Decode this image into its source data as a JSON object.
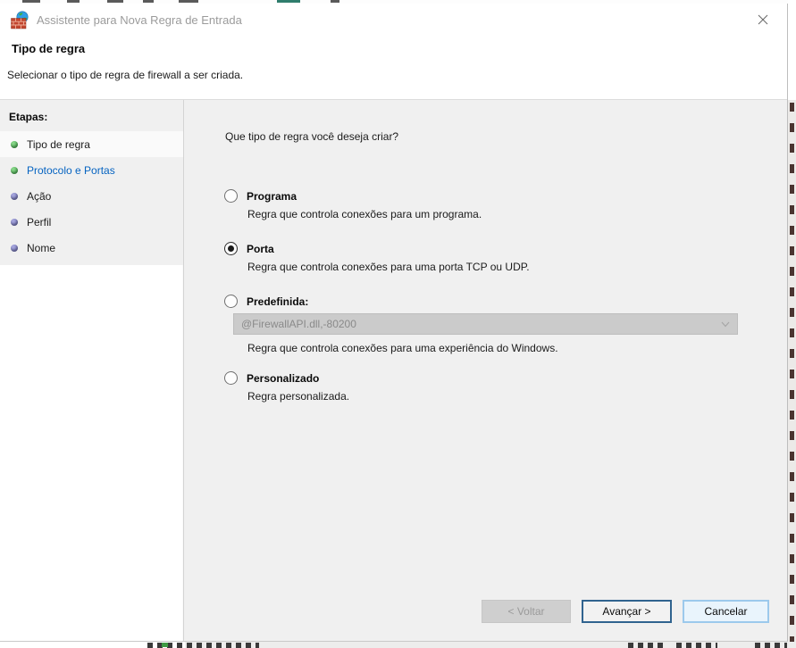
{
  "titlebar": {
    "title": "Assistente para Nova Regra de Entrada",
    "app_icon": "firewall-icon",
    "close_icon": "close-icon"
  },
  "header": {
    "title": "Tipo de regra",
    "subtitle": "Selecionar o tipo de regra de firewall a ser criada."
  },
  "sidebar": {
    "heading": "Etapas:",
    "steps": [
      {
        "label": "Tipo de regra",
        "current": true,
        "bullet_color": "#3fae49",
        "bullet_highlight": "#8fd98f",
        "label_color": "#1b1b1b"
      },
      {
        "label": "Protocolo e Portas",
        "current": false,
        "bullet_color": "#3fae49",
        "bullet_highlight": "#8fd98f",
        "label_color": "#0563c1"
      },
      {
        "label": "Ação",
        "current": false,
        "bullet_color": "#6f70bd",
        "bullet_highlight": "#aaaade",
        "label_color": "#1b1b1b"
      },
      {
        "label": "Perfil",
        "current": false,
        "bullet_color": "#6f70bd",
        "bullet_highlight": "#aaaade",
        "label_color": "#1b1b1b"
      },
      {
        "label": "Nome",
        "current": false,
        "bullet_color": "#6f70bd",
        "bullet_highlight": "#aaaade",
        "label_color": "#1b1b1b"
      }
    ]
  },
  "main": {
    "question": "Que tipo de regra você deseja criar?",
    "options": [
      {
        "label": "Programa",
        "selected": false,
        "description": "Regra que controla conexões para um programa."
      },
      {
        "label": "Porta",
        "selected": true,
        "description": "Regra que controla conexões para uma porta TCP ou UDP."
      },
      {
        "label": "Predefinida:",
        "selected": false,
        "description": "Regra que controla conexões para uma experiência do Windows.",
        "dropdown": {
          "value": "@FirewallAPI.dll,-80200",
          "disabled": true,
          "chevron_icon": "chevron-down-icon"
        }
      },
      {
        "label": "Personalizado",
        "selected": false,
        "description": "Regra personalizada."
      }
    ]
  },
  "footer": {
    "buttons": [
      {
        "label": "< Voltar",
        "state": "disabled"
      },
      {
        "label": "Avançar >",
        "state": "default"
      },
      {
        "label": "Cancelar",
        "state": "highlighted"
      }
    ]
  },
  "colors": {
    "dialog_background": "#f0f0f0",
    "step_done_bullet": "#3fae49",
    "step_pending_bullet": "#6f70bd",
    "step_link_text": "#0563c1",
    "focused_button_border": "#30638f",
    "disabled_field_background": "#cbcbcb"
  }
}
